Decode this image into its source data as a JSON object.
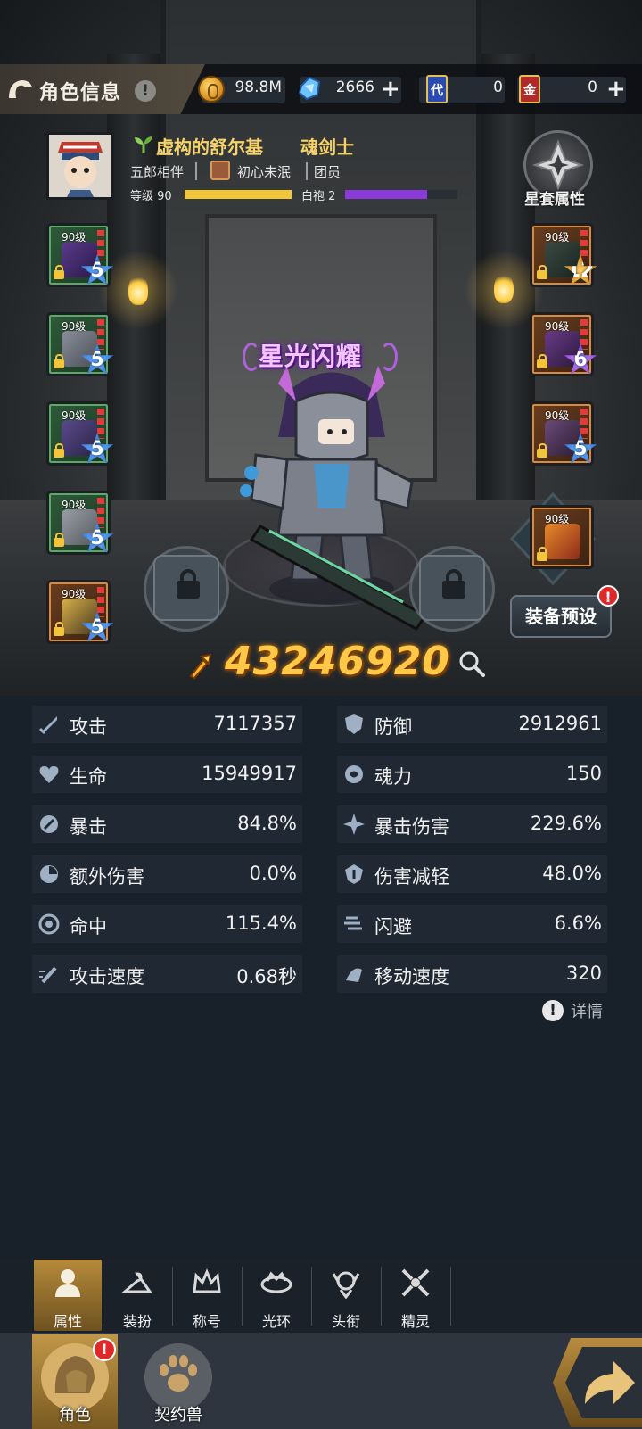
{
  "header": {
    "title": "角色信息",
    "info_icon": "!",
    "gold": "98.8M",
    "diamonds": "2666",
    "ticket_a_label": "代",
    "ticket_a": "0",
    "ticket_b_label": "金",
    "ticket_b": "0",
    "plus": "+"
  },
  "profile": {
    "name": "虚构的舒尔基",
    "class": "魂剑士",
    "companion": "五郎相伴",
    "title_badge": "初心未泯",
    "guild_role": "团员",
    "level_label": "等级 90",
    "level_progress": 1.0,
    "rank_label": "白袍 2",
    "rank_progress": 0.73,
    "star_set_label": "星套属性"
  },
  "equipment_left": [
    {
      "level": "90级",
      "stars": "5",
      "color": "green"
    },
    {
      "level": "90级",
      "stars": "5",
      "color": "green"
    },
    {
      "level": "90级",
      "stars": "5",
      "color": "green"
    },
    {
      "level": "90级",
      "stars": "5",
      "color": "green"
    },
    {
      "level": "90级",
      "stars": "5",
      "color": "orange"
    }
  ],
  "equipment_right": [
    {
      "level": "90级",
      "stars": "12",
      "color": "orange"
    },
    {
      "level": "90级",
      "stars": "6",
      "color": "orange"
    },
    {
      "level": "90级",
      "stars": "5",
      "color": "orange"
    },
    {
      "level": "90级",
      "stars": "",
      "color": "orange"
    }
  ],
  "character": {
    "title": "星光闪耀",
    "power": "43246920",
    "preset_label": "装备预设",
    "preset_alert": "!"
  },
  "stats": [
    {
      "name": "攻击",
      "value": "7117357",
      "icon": "sword-icon"
    },
    {
      "name": "防御",
      "value": "2912961",
      "icon": "shield-icon"
    },
    {
      "name": "生命",
      "value": "15949917",
      "icon": "heart-icon"
    },
    {
      "name": "魂力",
      "value": "150",
      "icon": "soul-icon"
    },
    {
      "name": "暴击",
      "value": "84.8%",
      "icon": "crit-icon"
    },
    {
      "name": "暴击伤害",
      "value": "229.6%",
      "icon": "crit-damage-icon"
    },
    {
      "name": "额外伤害",
      "value": "0.0%",
      "icon": "extra-damage-icon"
    },
    {
      "name": "伤害减轻",
      "value": "48.0%",
      "icon": "damage-reduction-icon"
    },
    {
      "name": "命中",
      "value": "115.4%",
      "icon": "target-icon"
    },
    {
      "name": "闪避",
      "value": "6.6%",
      "icon": "dodge-icon"
    },
    {
      "name": "攻击速度",
      "value": "0.68秒",
      "icon": "attack-speed-icon"
    },
    {
      "name": "移动速度",
      "value": "320",
      "icon": "move-speed-icon"
    }
  ],
  "detail": {
    "icon": "!",
    "label": "详情"
  },
  "subtabs": [
    {
      "label": "属性",
      "icon": "person-icon",
      "active": true
    },
    {
      "label": "装扮",
      "icon": "hanger-icon",
      "active": false
    },
    {
      "label": "称号",
      "icon": "crown-icon",
      "active": false
    },
    {
      "label": "光环",
      "icon": "halo-icon",
      "active": false
    },
    {
      "label": "头衔",
      "icon": "emblem-icon",
      "active": false
    },
    {
      "label": "精灵",
      "icon": "fairy-icon",
      "active": false
    }
  ],
  "bottom_tabs": [
    {
      "label": "角色",
      "icon": "character-icon",
      "active": true,
      "alert": "!"
    },
    {
      "label": "契约兽",
      "icon": "paw-icon",
      "active": false
    }
  ],
  "colors": {
    "accent_gold": "#ffc846",
    "level_bar": "#f2c53a",
    "rank_bar": "#8a3ad8",
    "panel_bg": "#18202a",
    "stat_row_bg": "#1f2833"
  }
}
